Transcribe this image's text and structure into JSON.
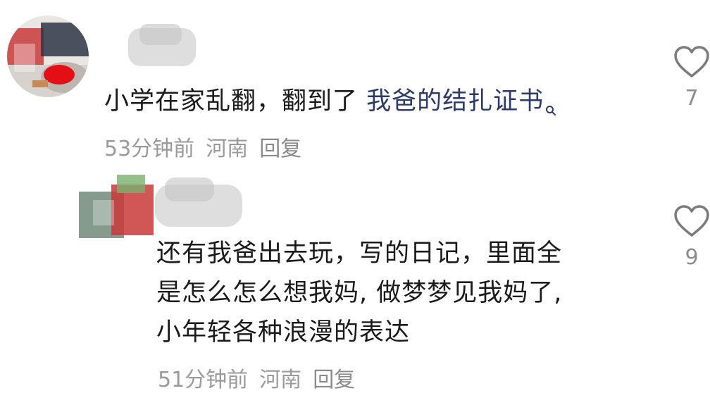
{
  "comments": [
    {
      "text_plain": "小学在家乱翻，翻到了 ",
      "text_link": "我爸的结扎证书",
      "time": "53分钟前",
      "location": "河南",
      "reply_label": "回复",
      "like_count": "7",
      "icons": {
        "search": "search-icon",
        "like": "heart-icon"
      }
    },
    {
      "lines": [
        "还有我爸出去玩，写的日记，里面全",
        "是怎么怎么想我妈, 做梦梦见我妈了,",
        "小年轻各种浪漫的表达"
      ],
      "time": "51分钟前",
      "location": "河南",
      "reply_label": "回复",
      "like_count": "9",
      "icons": {
        "like": "heart-icon"
      }
    }
  ],
  "colors": {
    "text": "#1a1a1a",
    "link": "#2b3a6b",
    "meta": "#9a9a9a",
    "icon": "#7a7a7a"
  }
}
